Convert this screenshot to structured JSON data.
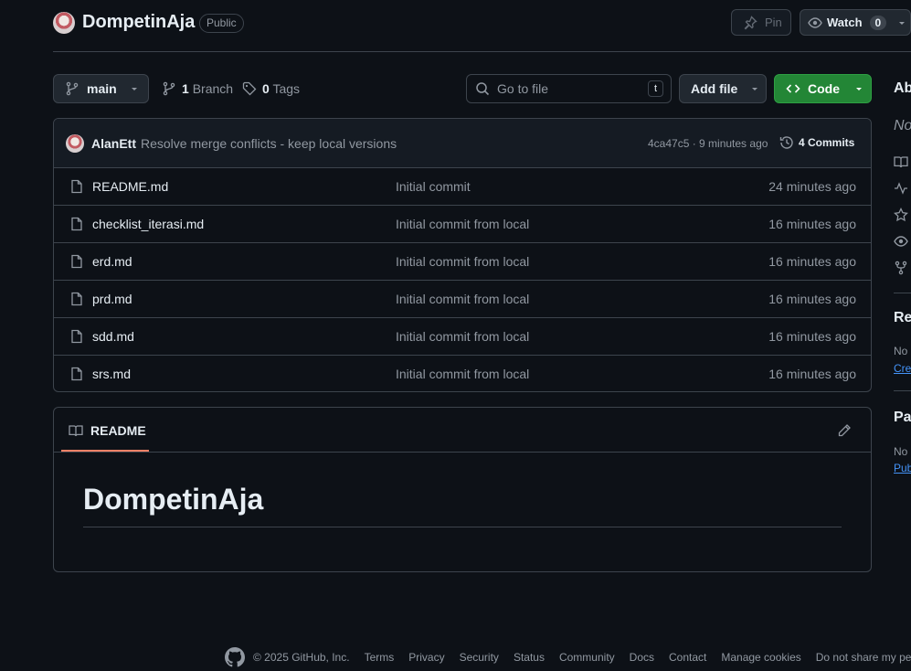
{
  "repo": {
    "name": "DompetinAja",
    "visibility": "Public"
  },
  "header": {
    "pin_label": "Pin",
    "watch_label": "Watch",
    "watch_count": "0"
  },
  "toolbar": {
    "branch": "main",
    "branch_count": "1",
    "branch_label": "Branch",
    "tags_count": "0",
    "tags_label": "Tags",
    "search_placeholder": "Go to file",
    "search_shortcut": "t",
    "add_file_label": "Add file",
    "code_label": "Code"
  },
  "latest_commit": {
    "author": "AlanEtt",
    "message": "Resolve merge conflicts - keep local versions",
    "sha_time": "4ca47c5 · 9 minutes ago",
    "commits_label": "4 Commits"
  },
  "files": [
    {
      "name": "README.md",
      "message": "Initial commit",
      "time": "24 minutes ago"
    },
    {
      "name": "checklist_iterasi.md",
      "message": "Initial commit from local",
      "time": "16 minutes ago"
    },
    {
      "name": "erd.md",
      "message": "Initial commit from local",
      "time": "16 minutes ago"
    },
    {
      "name": "prd.md",
      "message": "Initial commit from local",
      "time": "16 minutes ago"
    },
    {
      "name": "sdd.md",
      "message": "Initial commit from local",
      "time": "16 minutes ago"
    },
    {
      "name": "srs.md",
      "message": "Initial commit from local",
      "time": "16 minutes ago"
    }
  ],
  "readme": {
    "tab_label": "README",
    "heading": "DompetinAja"
  },
  "sidebar": {
    "about_label": "Ab",
    "about_desc": "No",
    "releases_label": "Re",
    "releases_text": "No",
    "releases_link": "Crea",
    "packages_label": "Pac",
    "packages_text": "No",
    "packages_link": "Pub"
  },
  "footer": {
    "copyright": "© 2025 GitHub, Inc.",
    "links": [
      "Terms",
      "Privacy",
      "Security",
      "Status",
      "Community",
      "Docs",
      "Contact",
      "Manage cookies",
      "Do not share my pers"
    ]
  }
}
